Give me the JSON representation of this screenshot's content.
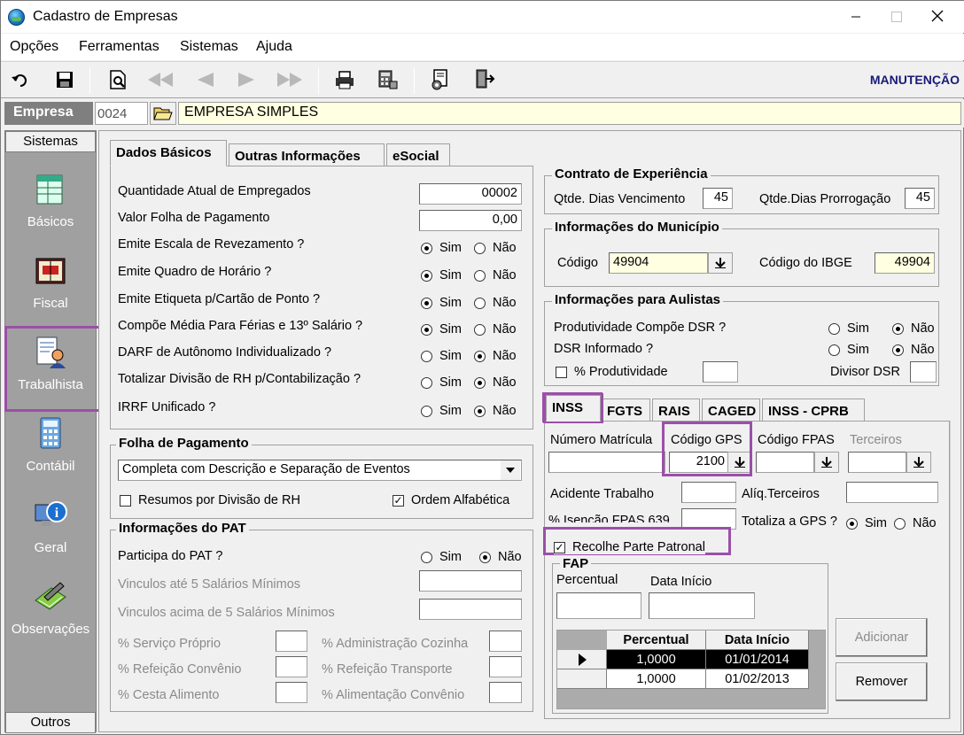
{
  "window": {
    "title": "Cadastro de Empresas",
    "min": "—",
    "max": "☐",
    "close": "✕"
  },
  "menu": [
    "Opções",
    "Ferramentas",
    "Sistemas",
    "Ajuda"
  ],
  "toolbar": {
    "mode_label": "MANUTENÇÃO"
  },
  "empresa": {
    "label": "Empresa",
    "code": "0024",
    "name": "EMPRESA SIMPLES"
  },
  "sidebar": {
    "header": "Sistemas",
    "footer": "Outros",
    "items": [
      "Básicos",
      "Fiscal",
      "Trabalhista",
      "Contábil",
      "Geral",
      "Observações"
    ]
  },
  "tabs": [
    "Dados Básicos",
    "Outras Informações",
    "eSocial"
  ],
  "dados": {
    "qtd_label": "Quantidade Atual de Empregados",
    "qtd_value": "00002",
    "folha_label": "Valor Folha de Pagamento",
    "folha_value": "0,00",
    "sim": "Sim",
    "nao": "Não",
    "questions": [
      "Emite Escala de Revezamento ?",
      "Emite Quadro de Horário ?",
      "Emite Etiqueta p/Cartão de Ponto ?",
      "Compõe Média Para Férias e 13º Salário ?",
      "DARF de Autônomo Individualizado ?",
      "Totalizar Divisão de RH p/Contabilização ?",
      "IRRF Unificado ?"
    ],
    "answers": [
      "sim",
      "sim",
      "sim",
      "sim",
      "nao",
      "nao",
      "nao"
    ]
  },
  "folha": {
    "title": "Folha de Pagamento",
    "select_value": "Completa com Descrição e Separação de Eventos",
    "resumos_label": "Resumos por Divisão de RH",
    "ordem_label": "Ordem Alfabética",
    "ordem_checked": true
  },
  "pat": {
    "title": "Informações do PAT",
    "participa_label": "Participa do PAT ?",
    "participa": "nao",
    "vinc_ate": "Vinculos até 5 Salários Mínimos",
    "vinc_acima": "Vinculos acima de 5 Salários Mínimos",
    "pct_left": [
      "% Serviço Próprio",
      "% Refeição Convênio",
      "% Cesta Alimento"
    ],
    "pct_right": [
      "% Administração Cozinha",
      "% Refeição Transporte",
      "% Alimentação Convênio"
    ]
  },
  "contrato": {
    "title": "Contrato de Experiência",
    "venc_label": "Qtde. Dias Vencimento",
    "venc_value": "45",
    "prorr_label": "Qtde.Dias Prorrogação",
    "prorr_value": "45"
  },
  "municipio": {
    "title": "Informações do Município",
    "codigo_label": "Código",
    "codigo_value": "49904",
    "ibge_label": "Código do IBGE",
    "ibge_value": "49904"
  },
  "aulistas": {
    "title": "Informações para Aulistas",
    "prod_label": "Produtividade Compõe DSR ?",
    "dsr_label": "DSR Informado ?",
    "pct_prod_label": "% Produtividade",
    "divisor_label": "Divisor DSR"
  },
  "subtabs": [
    "INSS",
    "FGTS",
    "RAIS",
    "CAGED",
    "INSS - CPRB"
  ],
  "inss": {
    "matricula_label": "Número Matrícula",
    "gps_label": "Código GPS",
    "gps_value": "2100",
    "fpas_label": "Código FPAS",
    "terceiros_label": "Terceiros",
    "acidente_label": "Acidente Trabalho",
    "aliq_label": "Alíq.Terceiros",
    "isencao_label": "% Isenção FPAS 639",
    "totaliza_label": "Totaliza a GPS ?",
    "recolhe_label": "Recolhe Parte Patronal",
    "recolhe_checked": true
  },
  "fap": {
    "title": "FAP",
    "pct_label": "Percentual",
    "data_label": "Data Início",
    "columns": [
      "Percentual",
      "Data Início"
    ],
    "rows": [
      [
        "1,0000",
        "01/01/2014"
      ],
      [
        "1,0000",
        "01/02/2013"
      ]
    ],
    "add_label": "Adicionar",
    "remove_label": "Remover"
  }
}
